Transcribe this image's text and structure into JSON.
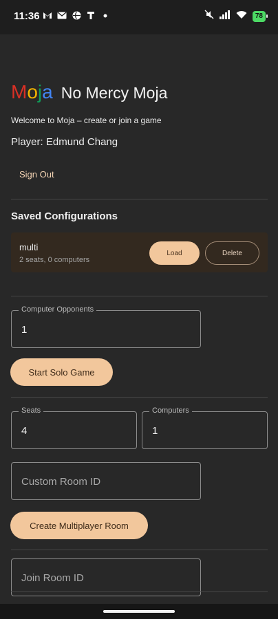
{
  "status_bar": {
    "time": "11:36",
    "left_icons": [
      "gmail-icon",
      "mail-icon",
      "sports-icon",
      "tmobile-icon",
      "dot-icon"
    ],
    "right_icons": [
      "mute-icon",
      "signal-icon",
      "wifi-icon"
    ],
    "battery": "78"
  },
  "app": {
    "logo_letters": [
      {
        "ch": "M",
        "color": "#d93025"
      },
      {
        "ch": "o",
        "color": "#f4b400"
      },
      {
        "ch": "j",
        "color": "#0f9d58"
      },
      {
        "ch": "a",
        "color": "#4285f4"
      }
    ],
    "title": "No Mercy Moja",
    "welcome": "Welcome to Moja – create or join a game",
    "player": "Player: Edmund Chang",
    "sign_out": "Sign Out"
  },
  "saved": {
    "title": "Saved Configurations",
    "items": [
      {
        "name": "multi",
        "meta": "2 seats, 0 computers",
        "load_label": "Load",
        "delete_label": "Delete"
      }
    ]
  },
  "solo": {
    "opponents_label": "Computer Opponents",
    "opponents_value": "1",
    "start_label": "Start Solo Game"
  },
  "multiplayer": {
    "seats_label": "Seats",
    "seats_value": "4",
    "computers_label": "Computers",
    "computers_value": "1",
    "room_placeholder": "Custom Room ID",
    "create_label": "Create Multiplayer Room"
  },
  "join": {
    "room_placeholder": "Join Room ID"
  },
  "colors": {
    "background": "#282828",
    "accent": "#f2c79c",
    "card": "#33291f"
  }
}
